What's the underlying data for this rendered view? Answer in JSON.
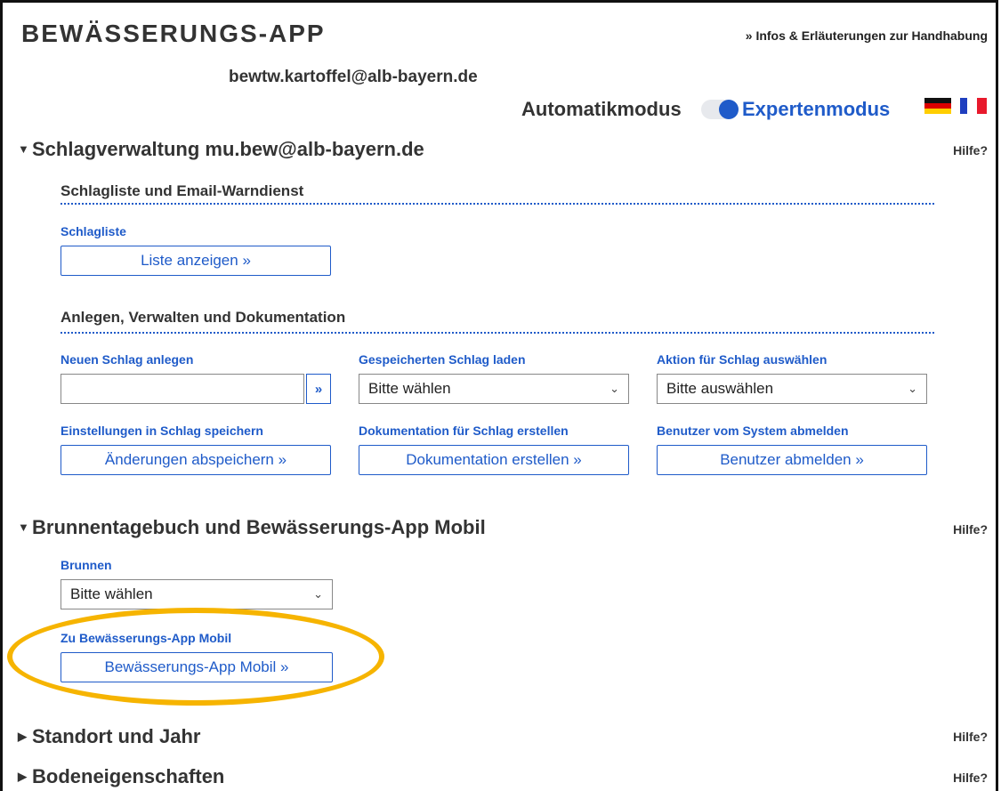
{
  "header": {
    "app_title": "BEWÄSSERUNGS-APP",
    "info_link": "» Infos & Erläuterungen zur Handhabung",
    "email": "bewtw.kartoffel@alb-bayern.de",
    "mode_auto": "Automatikmodus",
    "mode_expert": "Expertenmodus",
    "mode_expert_active": true,
    "flags": [
      "flag-de-icon",
      "flag-fr-icon"
    ],
    "accent_color": "#1f5bc9"
  },
  "sections": {
    "schlagverwaltung": {
      "title": "Schlagverwaltung mu.bew@alb-bayern.de",
      "hilfe": "Hilfe?",
      "sub1_title": "Schlagliste und Email-Warndienst",
      "schlagliste_label": "Schlagliste",
      "schlagliste_button": "Liste anzeigen »",
      "sub2_title": "Anlegen, Verwalten und Dokumentation",
      "neuer_schlag_label": "Neuen Schlag anlegen",
      "neuer_schlag_value": "",
      "neuer_schlag_go": "»",
      "gespeichert_label": "Gespeicherten Schlag laden",
      "gespeichert_select": "Bitte wählen",
      "aktion_label": "Aktion für Schlag auswählen",
      "aktion_select": "Bitte auswählen",
      "einstellungen_label": "Einstellungen in Schlag speichern",
      "einstellungen_button": "Änderungen abspeichern »",
      "doku_label": "Dokumentation für Schlag erstellen",
      "doku_button": "Dokumentation erstellen »",
      "abmelden_label": "Benutzer vom System abmelden",
      "abmelden_button": "Benutzer abmelden »"
    },
    "brunnen": {
      "title": "Brunnentagebuch und Bewässerungs-App Mobil",
      "hilfe": "Hilfe?",
      "brunnen_label": "Brunnen",
      "brunnen_select": "Bitte wählen",
      "mobil_label": "Zu Bewässerungs-App Mobil",
      "mobil_button": "Bewässerungs-App Mobil »",
      "highlight_color": "#f6b400"
    },
    "standort": {
      "title": "Standort und Jahr",
      "hilfe": "Hilfe?"
    },
    "boden": {
      "title": "Bodeneigenschaften",
      "hilfe": "Hilfe?"
    }
  }
}
